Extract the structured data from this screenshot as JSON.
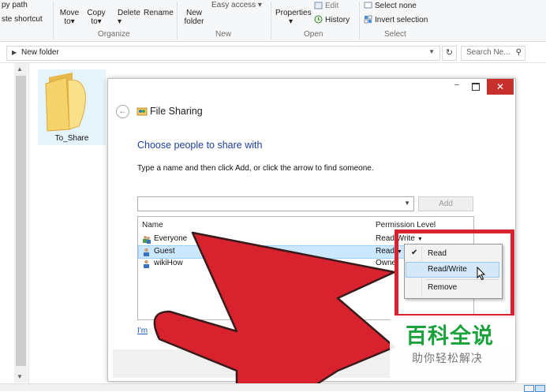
{
  "ribbon": {
    "copy_path": "py path",
    "paste_shortcut": "ste shortcut",
    "move_to": "Move to▾",
    "copy_to": "Copy to▾",
    "delete": "Delete",
    "rename": "Rename",
    "new_folder": "New folder",
    "easy_access": "Easy access ▾",
    "properties": "Properties",
    "edit": "Edit",
    "history": "History",
    "select_none": "Select none",
    "invert_selection": "Invert selection",
    "groups": {
      "organize": "Organize",
      "new": "New",
      "open": "Open",
      "select": "Select"
    }
  },
  "address": {
    "path": "New folder",
    "search_placeholder": "Search Ne..."
  },
  "folder": {
    "label": "To_Share",
    "color": "#f2d06b"
  },
  "dialog": {
    "title": "File Sharing",
    "heading": "Choose people to share with",
    "instruction": "Type a name and then click Add, or click the arrow to find someone.",
    "add_button": "Add",
    "columns": {
      "name": "Name",
      "permission": "Permission Level"
    },
    "rows": [
      {
        "name": "Everyone",
        "permission": "Read/Write",
        "selected": false,
        "icon": "users-group-icon"
      },
      {
        "name": "Guest",
        "permission": "Read",
        "selected": true,
        "icon": "user-icon"
      },
      {
        "name": "wikiHow",
        "permission": "Owne",
        "selected": false,
        "icon": "user-icon"
      }
    ],
    "help_link": "I'm",
    "close_glyph": "✕",
    "minimize_glyph": "–"
  },
  "context_menu": {
    "items": [
      {
        "label": "Read",
        "checked": true
      },
      {
        "label": "Read/Write",
        "hover": true
      },
      {
        "label": "Remove"
      }
    ]
  },
  "watermark": {
    "logo": "百科全说",
    "subtitle": "助你轻松解决"
  },
  "colors": {
    "accent_red": "#d8232f",
    "heading_blue": "#1e3e9e",
    "close_red": "#c7302c"
  }
}
